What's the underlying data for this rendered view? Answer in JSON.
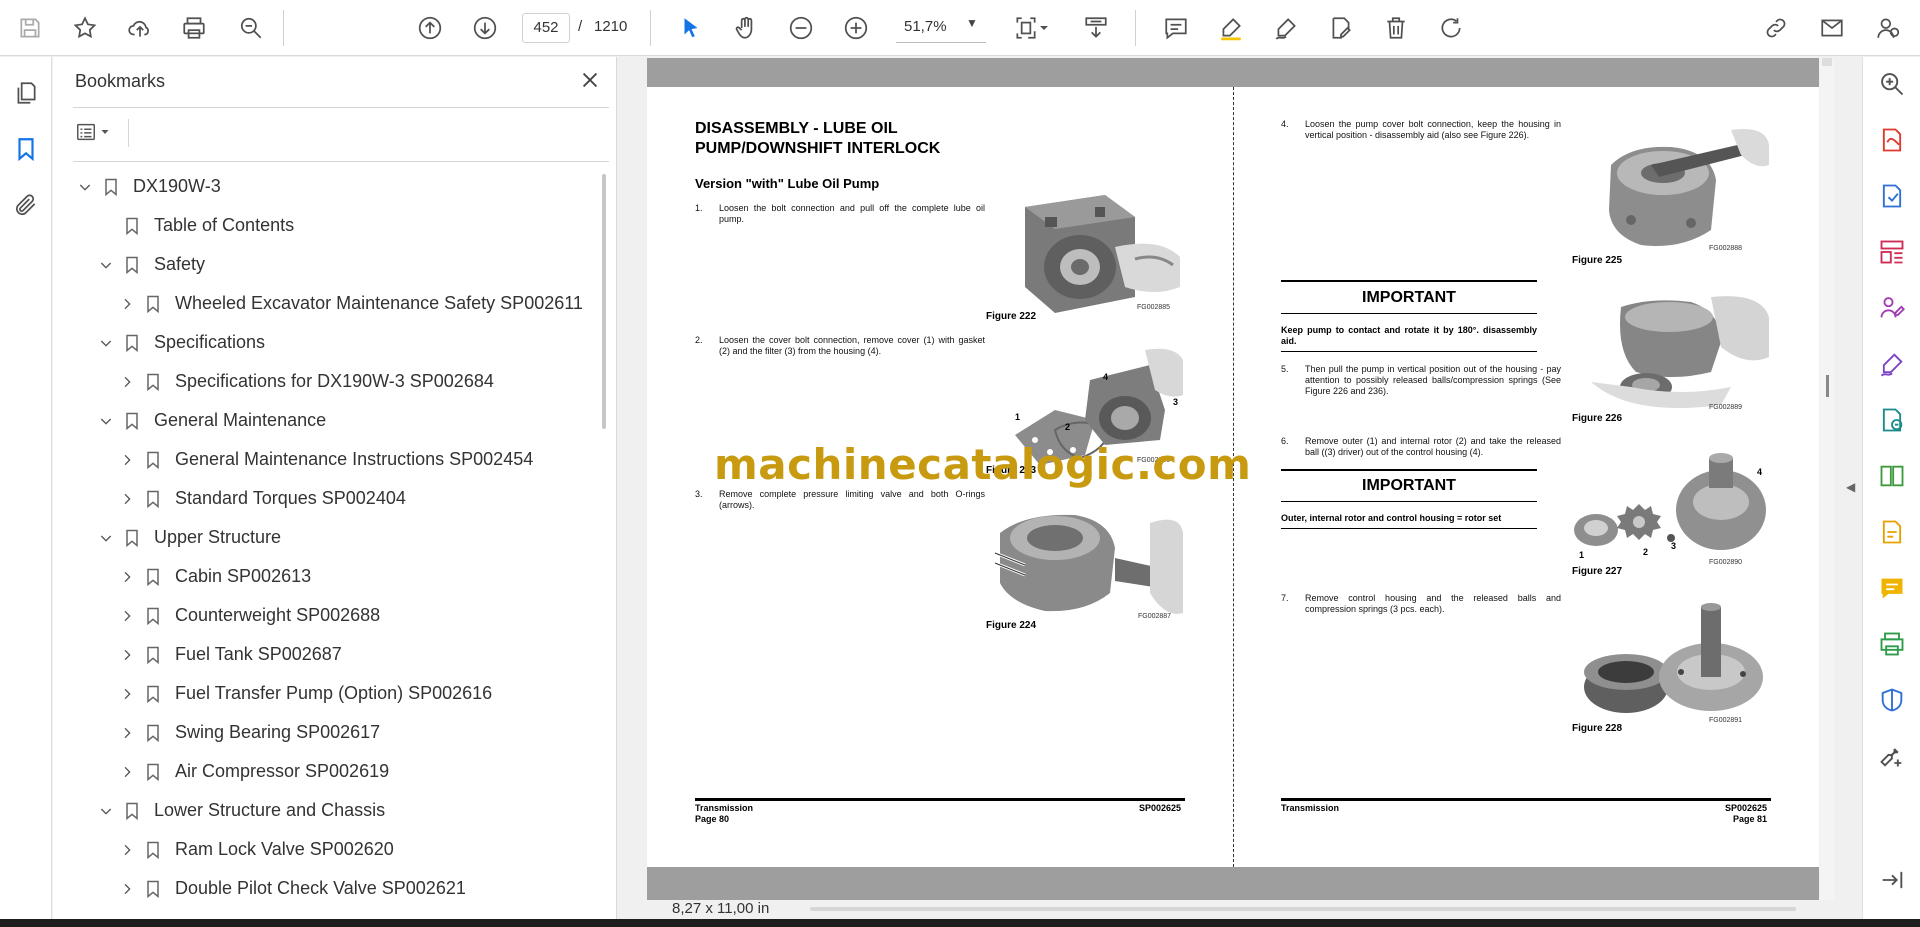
{
  "toolbar": {
    "current_page": "452",
    "page_separator": "/",
    "total_pages": "1210",
    "zoom": "51,7%"
  },
  "bookmarks": {
    "title": "Bookmarks",
    "items": [
      {
        "label": "DX190W-3",
        "level": 0,
        "expanded": true,
        "has_children": true
      },
      {
        "label": "Table of Contents",
        "level": 1,
        "expanded": false,
        "has_children": false
      },
      {
        "label": "Safety",
        "level": 1,
        "expanded": true,
        "has_children": true
      },
      {
        "label": "Wheeled Excavator Maintenance Safety SP002611",
        "level": 2,
        "expanded": false,
        "has_children": true
      },
      {
        "label": "Specifications",
        "level": 1,
        "expanded": true,
        "has_children": true
      },
      {
        "label": "Specifications for DX190W-3 SP002684",
        "level": 2,
        "expanded": false,
        "has_children": true
      },
      {
        "label": "General Maintenance",
        "level": 1,
        "expanded": true,
        "has_children": true
      },
      {
        "label": "General Maintenance Instructions SP002454",
        "level": 2,
        "expanded": false,
        "has_children": true
      },
      {
        "label": "Standard Torques SP002404",
        "level": 2,
        "expanded": false,
        "has_children": true
      },
      {
        "label": "Upper Structure",
        "level": 1,
        "expanded": true,
        "has_children": true
      },
      {
        "label": "Cabin SP002613",
        "level": 2,
        "expanded": false,
        "has_children": true
      },
      {
        "label": "Counterweight SP002688",
        "level": 2,
        "expanded": false,
        "has_children": true
      },
      {
        "label": "Fuel Tank SP002687",
        "level": 2,
        "expanded": false,
        "has_children": true
      },
      {
        "label": "Fuel Transfer Pump (Option) SP002616",
        "level": 2,
        "expanded": false,
        "has_children": true
      },
      {
        "label": "Swing Bearing SP002617",
        "level": 2,
        "expanded": false,
        "has_children": true
      },
      {
        "label": "Air Compressor SP002619",
        "level": 2,
        "expanded": false,
        "has_children": true
      },
      {
        "label": "Lower Structure and Chassis",
        "level": 1,
        "expanded": true,
        "has_children": true
      },
      {
        "label": "Ram Lock Valve SP002620",
        "level": 2,
        "expanded": false,
        "has_children": true
      },
      {
        "label": "Double Pilot Check Valve SP002621",
        "level": 2,
        "expanded": false,
        "has_children": true
      }
    ]
  },
  "document": {
    "left_page": {
      "title": "DISASSEMBLY - LUBE OIL PUMP/DOWNSHIFT INTERLOCK",
      "subtitle": "Version \"with\" Lube Oil Pump",
      "steps": [
        {
          "num": "1.",
          "text": "Loosen the bolt connection and pull off the complete lube oil pump."
        },
        {
          "num": "2.",
          "text": "Loosen the cover bolt connection, remove cover (1) with gasket (2) and the filter (3) from the housing (4)."
        },
        {
          "num": "3.",
          "text": "Remove complete pressure limiting valve and both O-rings (arrows)."
        }
      ],
      "figures": [
        {
          "caption": "Figure 222",
          "code": "FG002885"
        },
        {
          "caption": "Figure 223",
          "code": "FG002886"
        },
        {
          "caption": "Figure 224",
          "code": "FG002887"
        }
      ],
      "callouts": [
        "1",
        "2",
        "3",
        "4"
      ],
      "footer_left_1": "Transmission",
      "footer_left_2": "Page 80",
      "footer_right": "SP002625"
    },
    "right_page": {
      "steps": [
        {
          "num": "4.",
          "text": "Loosen the pump cover bolt connection, keep the housing in vertical position - disassembly aid (also see Figure 226)."
        },
        {
          "num": "5.",
          "text": "Then pull the pump in vertical position out of the housing - pay attention to possibly released balls/compression springs (See Figure 226 and 236)."
        },
        {
          "num": "6.",
          "text": "Remove outer (1) and internal rotor (2) and take the released ball ((3) driver) out of the control housing (4)."
        },
        {
          "num": "7.",
          "text": "Remove control housing and the released balls and compression springs (3 pcs. each)."
        }
      ],
      "important_1": {
        "title": "IMPORTANT",
        "text": "Keep pump to contact and rotate it by 180°. disassembly aid."
      },
      "important_2": {
        "title": "IMPORTANT",
        "text": "Outer, internal rotor and control housing = rotor set"
      },
      "figures": [
        {
          "caption": "Figure 225",
          "code": "FG002888"
        },
        {
          "caption": "Figure 226",
          "code": "FG002889"
        },
        {
          "caption": "Figure 227",
          "code": "FG002890"
        },
        {
          "caption": "Figure 228",
          "code": "FG002891"
        }
      ],
      "callouts": [
        "1",
        "2",
        "3",
        "4"
      ],
      "footer_left": "Transmission",
      "footer_right_1": "SP002625",
      "footer_right_2": "Page 81"
    },
    "watermark": "machinecatalogic.com"
  },
  "status": {
    "page_size": "8,27 x 11,00 in"
  }
}
